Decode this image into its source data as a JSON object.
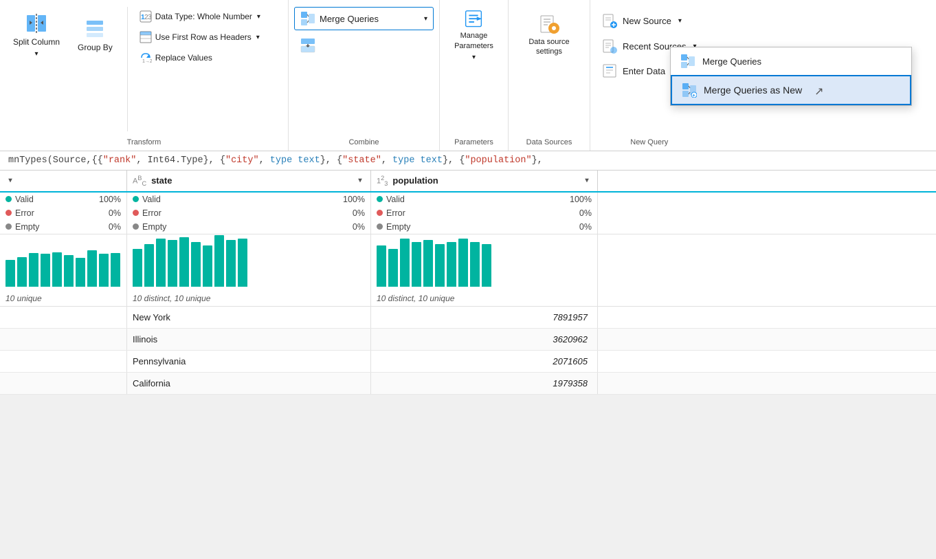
{
  "ribbon": {
    "groups": {
      "transform": {
        "label": "Transform",
        "split_column": "Split\nColumn",
        "group_by": "Group By",
        "data_type_label": "Data Type: Whole Number",
        "data_type_arrow": "▾",
        "use_first_row": "Use First Row as Headers",
        "use_first_row_arrow": "▾",
        "replace_values": "Replace Values"
      },
      "combine": {
        "label": "Combine",
        "merge_queries": "Merge Queries",
        "merge_queries_arrow": "▾",
        "append_icon": "append"
      },
      "dropdown": {
        "merge_queries_item": "Merge Queries",
        "merge_as_new_item": "Merge Queries as New"
      },
      "parameters": {
        "label": "Parameters",
        "manage_label": "Manage\nParameters",
        "manage_arrow": "▾"
      },
      "data_sources": {
        "label": "Data Sources",
        "data_source_settings": "Data source settings"
      },
      "new_query": {
        "label": "New Query",
        "new_source": "New Source",
        "new_source_arrow": "▾",
        "recent_sources": "Recent Sources",
        "recent_sources_arrow": "▾",
        "enter_data": "Enter Data"
      }
    }
  },
  "formula_bar": {
    "text": "mnTypes(Source,{{\"rank\", Int64.Type}, {\"city\", type text}, {\"state\", type text}, {\"population\","
  },
  "grid": {
    "columns": [
      {
        "id": "first",
        "type": "",
        "name": ""
      },
      {
        "id": "state",
        "type": "ABC",
        "type_num": "",
        "name": "state"
      },
      {
        "id": "population",
        "type": "123",
        "name": "population"
      }
    ],
    "stats": {
      "state": {
        "valid_pct": "100%",
        "error_pct": "0%",
        "empty_pct": "0%",
        "valid_label": "Valid",
        "error_label": "Error",
        "empty_label": "Empty"
      },
      "population": {
        "valid_pct": "100%",
        "error_pct": "0%",
        "empty_pct": "0%",
        "valid_label": "Valid",
        "error_label": "Error",
        "empty_label": "Empty"
      },
      "first": {
        "valid_pct": "100%",
        "error_pct": "0%",
        "empty_pct": "0%"
      }
    },
    "bar_charts": {
      "state_bars": [
        55,
        62,
        70,
        68,
        72,
        65,
        60,
        75,
        68,
        70
      ],
      "population_bars": [
        60,
        55,
        70,
        65,
        68,
        62,
        65,
        70,
        65,
        62
      ]
    },
    "distinct": {
      "first": "10 unique",
      "state": "10 distinct, 10 unique",
      "population": "10 distinct, 10 unique"
    },
    "rows": [
      {
        "first": "",
        "state": "New York",
        "population": "7891957"
      },
      {
        "first": "",
        "state": "Illinois",
        "population": "3620962"
      },
      {
        "first": "",
        "state": "Pennsylvania",
        "population": "2071605"
      },
      {
        "first": "",
        "state": "California",
        "population": "1979358"
      }
    ]
  },
  "colors": {
    "accent": "#0078d4",
    "teal": "#00b4a0",
    "border_highlight": "#00b4d8"
  }
}
